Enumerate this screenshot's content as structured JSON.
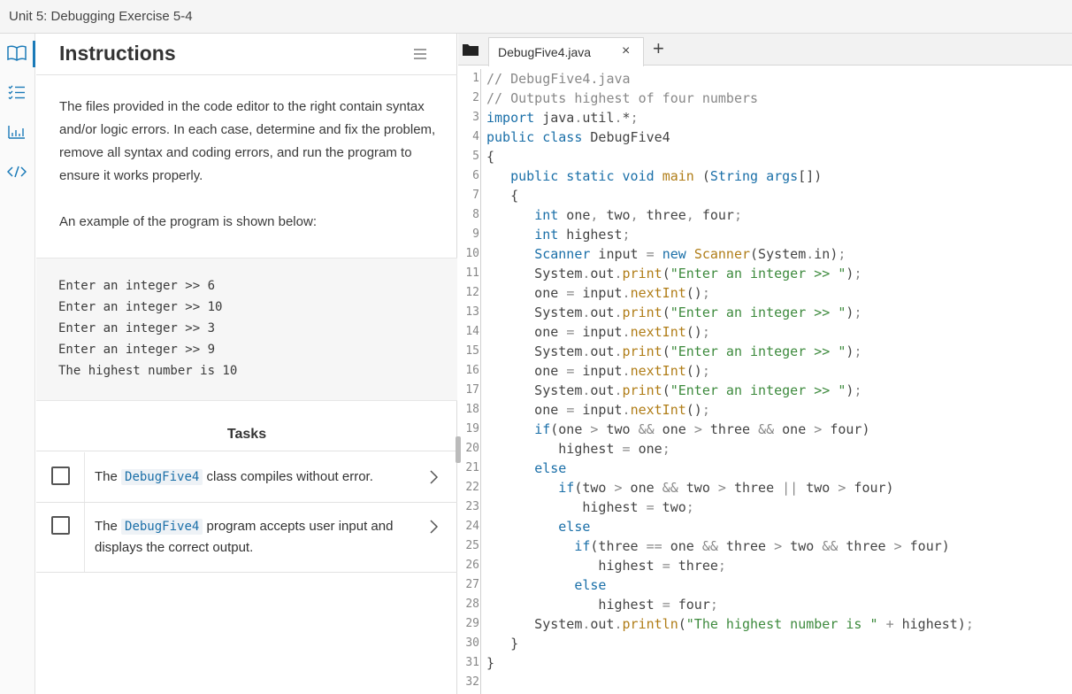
{
  "window": {
    "title": "Unit 5: Debugging Exercise 5-4"
  },
  "rail": {
    "icons": [
      "book-icon",
      "list-icon",
      "chart-icon",
      "code-icon"
    ]
  },
  "instructions": {
    "heading": "Instructions",
    "intro": "The files provided in the code editor to the right contain syntax and/or logic errors. In each case, determine and fix the problem, remove all syntax and coding errors, and run the program to ensure it works properly.",
    "example_label": "An example of the program is shown below:",
    "sample_output": [
      "Enter an integer >> 6",
      "Enter an integer >> 10",
      "Enter an integer >> 3",
      "Enter an integer >> 9",
      "The highest number is 10"
    ]
  },
  "tasks": {
    "heading": "Tasks",
    "items": [
      {
        "prefix": "The ",
        "code": "DebugFive4",
        "suffix": " class compiles without error."
      },
      {
        "prefix": "The ",
        "code": "DebugFive4",
        "suffix": " program accepts user input and displays the correct output."
      }
    ]
  },
  "editor": {
    "tab_label": "DebugFive4.java",
    "close_glyph": "×",
    "new_tab_glyph": "+",
    "line_numbers": [
      "1",
      "2",
      "3",
      "4",
      "5",
      "6",
      "7",
      "8",
      "9",
      "10",
      "11",
      "12",
      "13",
      "14",
      "15",
      "16",
      "17",
      "18",
      "19",
      "20",
      "21",
      "22",
      "23",
      "24",
      "25",
      "26",
      "27",
      "28",
      "29",
      "30",
      "31",
      "32"
    ],
    "lines": [
      [
        [
          "c",
          "// DebugFive4.java"
        ]
      ],
      [
        [
          "c",
          "// Outputs highest of four numbers"
        ]
      ],
      [
        [
          "k",
          "import"
        ],
        [
          "p",
          " java"
        ],
        [
          "o",
          "."
        ],
        [
          "p",
          "util"
        ],
        [
          "o",
          "."
        ],
        [
          "p",
          "*"
        ],
        [
          "o",
          ";"
        ]
      ],
      [
        [
          "k",
          "public class"
        ],
        [
          "p",
          " DebugFive4"
        ]
      ],
      [
        [
          "p",
          "{"
        ]
      ],
      [
        [
          "p",
          "   "
        ],
        [
          "k",
          "public static void"
        ],
        [
          "p",
          " "
        ],
        [
          "f",
          "main"
        ],
        [
          "p",
          " ("
        ],
        [
          "t",
          "String"
        ],
        [
          "p",
          " "
        ],
        [
          "t",
          "args"
        ],
        [
          "p",
          "[])"
        ]
      ],
      [
        [
          "p",
          "   {"
        ]
      ],
      [
        [
          "p",
          "      "
        ],
        [
          "t",
          "int"
        ],
        [
          "p",
          " one"
        ],
        [
          "o",
          ","
        ],
        [
          "p",
          " two"
        ],
        [
          "o",
          ","
        ],
        [
          "p",
          " three"
        ],
        [
          "o",
          ","
        ],
        [
          "p",
          " four"
        ],
        [
          "o",
          ";"
        ]
      ],
      [
        [
          "p",
          "      "
        ],
        [
          "t",
          "int"
        ],
        [
          "p",
          " highest"
        ],
        [
          "o",
          ";"
        ]
      ],
      [
        [
          "p",
          "      "
        ],
        [
          "t",
          "Scanner"
        ],
        [
          "p",
          " input "
        ],
        [
          "o",
          "="
        ],
        [
          "p",
          " "
        ],
        [
          "k",
          "new"
        ],
        [
          "p",
          " "
        ],
        [
          "f",
          "Scanner"
        ],
        [
          "p",
          "(System"
        ],
        [
          "o",
          "."
        ],
        [
          "p",
          "in)"
        ],
        [
          "o",
          ";"
        ]
      ],
      [
        [
          "p",
          "      System"
        ],
        [
          "o",
          "."
        ],
        [
          "p",
          "out"
        ],
        [
          "o",
          "."
        ],
        [
          "f",
          "print"
        ],
        [
          "p",
          "("
        ],
        [
          "s",
          "\"Enter an integer >> \""
        ],
        [
          "p",
          ")"
        ],
        [
          "o",
          ";"
        ]
      ],
      [
        [
          "p",
          "      one "
        ],
        [
          "o",
          "="
        ],
        [
          "p",
          " input"
        ],
        [
          "o",
          "."
        ],
        [
          "f",
          "nextInt"
        ],
        [
          "p",
          "()"
        ],
        [
          "o",
          ";"
        ]
      ],
      [
        [
          "p",
          "      System"
        ],
        [
          "o",
          "."
        ],
        [
          "p",
          "out"
        ],
        [
          "o",
          "."
        ],
        [
          "f",
          "print"
        ],
        [
          "p",
          "("
        ],
        [
          "s",
          "\"Enter an integer >> \""
        ],
        [
          "p",
          ")"
        ],
        [
          "o",
          ";"
        ]
      ],
      [
        [
          "p",
          "      one "
        ],
        [
          "o",
          "="
        ],
        [
          "p",
          " input"
        ],
        [
          "o",
          "."
        ],
        [
          "f",
          "nextInt"
        ],
        [
          "p",
          "()"
        ],
        [
          "o",
          ";"
        ]
      ],
      [
        [
          "p",
          "      System"
        ],
        [
          "o",
          "."
        ],
        [
          "p",
          "out"
        ],
        [
          "o",
          "."
        ],
        [
          "f",
          "print"
        ],
        [
          "p",
          "("
        ],
        [
          "s",
          "\"Enter an integer >> \""
        ],
        [
          "p",
          ")"
        ],
        [
          "o",
          ";"
        ]
      ],
      [
        [
          "p",
          "      one "
        ],
        [
          "o",
          "="
        ],
        [
          "p",
          " input"
        ],
        [
          "o",
          "."
        ],
        [
          "f",
          "nextInt"
        ],
        [
          "p",
          "()"
        ],
        [
          "o",
          ";"
        ]
      ],
      [
        [
          "p",
          "      System"
        ],
        [
          "o",
          "."
        ],
        [
          "p",
          "out"
        ],
        [
          "o",
          "."
        ],
        [
          "f",
          "print"
        ],
        [
          "p",
          "("
        ],
        [
          "s",
          "\"Enter an integer >> \""
        ],
        [
          "p",
          ")"
        ],
        [
          "o",
          ";"
        ]
      ],
      [
        [
          "p",
          "      one "
        ],
        [
          "o",
          "="
        ],
        [
          "p",
          " input"
        ],
        [
          "o",
          "."
        ],
        [
          "f",
          "nextInt"
        ],
        [
          "p",
          "()"
        ],
        [
          "o",
          ";"
        ]
      ],
      [
        [
          "p",
          "      "
        ],
        [
          "k",
          "if"
        ],
        [
          "p",
          "(one "
        ],
        [
          "o",
          ">"
        ],
        [
          "p",
          " two "
        ],
        [
          "o",
          "&&"
        ],
        [
          "p",
          " one "
        ],
        [
          "o",
          ">"
        ],
        [
          "p",
          " three "
        ],
        [
          "o",
          "&&"
        ],
        [
          "p",
          " one "
        ],
        [
          "o",
          ">"
        ],
        [
          "p",
          " four)"
        ]
      ],
      [
        [
          "p",
          "         highest "
        ],
        [
          "o",
          "="
        ],
        [
          "p",
          " one"
        ],
        [
          "o",
          ";"
        ]
      ],
      [
        [
          "p",
          "      "
        ],
        [
          "k",
          "else"
        ]
      ],
      [
        [
          "p",
          "         "
        ],
        [
          "k",
          "if"
        ],
        [
          "p",
          "(two "
        ],
        [
          "o",
          ">"
        ],
        [
          "p",
          " one "
        ],
        [
          "o",
          "&&"
        ],
        [
          "p",
          " two "
        ],
        [
          "o",
          ">"
        ],
        [
          "p",
          " three "
        ],
        [
          "o",
          "||"
        ],
        [
          "p",
          " two "
        ],
        [
          "o",
          ">"
        ],
        [
          "p",
          " four)"
        ]
      ],
      [
        [
          "p",
          "            highest "
        ],
        [
          "o",
          "="
        ],
        [
          "p",
          " two"
        ],
        [
          "o",
          ";"
        ]
      ],
      [
        [
          "p",
          "         "
        ],
        [
          "k",
          "else"
        ]
      ],
      [
        [
          "p",
          "           "
        ],
        [
          "k",
          "if"
        ],
        [
          "p",
          "(three "
        ],
        [
          "o",
          "=="
        ],
        [
          "p",
          " one "
        ],
        [
          "o",
          "&&"
        ],
        [
          "p",
          " three "
        ],
        [
          "o",
          ">"
        ],
        [
          "p",
          " two "
        ],
        [
          "o",
          "&&"
        ],
        [
          "p",
          " three "
        ],
        [
          "o",
          ">"
        ],
        [
          "p",
          " four)"
        ]
      ],
      [
        [
          "p",
          "              highest "
        ],
        [
          "o",
          "="
        ],
        [
          "p",
          " three"
        ],
        [
          "o",
          ";"
        ]
      ],
      [
        [
          "p",
          "           "
        ],
        [
          "k",
          "else"
        ]
      ],
      [
        [
          "p",
          "              highest "
        ],
        [
          "o",
          "="
        ],
        [
          "p",
          " four"
        ],
        [
          "o",
          ";"
        ]
      ],
      [
        [
          "p",
          "      System"
        ],
        [
          "o",
          "."
        ],
        [
          "p",
          "out"
        ],
        [
          "o",
          "."
        ],
        [
          "f",
          "println"
        ],
        [
          "p",
          "("
        ],
        [
          "s",
          "\"The highest number is \""
        ],
        [
          "p",
          " "
        ],
        [
          "o",
          "+"
        ],
        [
          "p",
          " highest)"
        ],
        [
          "o",
          ";"
        ]
      ],
      [
        [
          "p",
          "   }"
        ]
      ],
      [
        [
          "p",
          "}"
        ]
      ],
      [
        [
          "p",
          ""
        ]
      ]
    ]
  }
}
